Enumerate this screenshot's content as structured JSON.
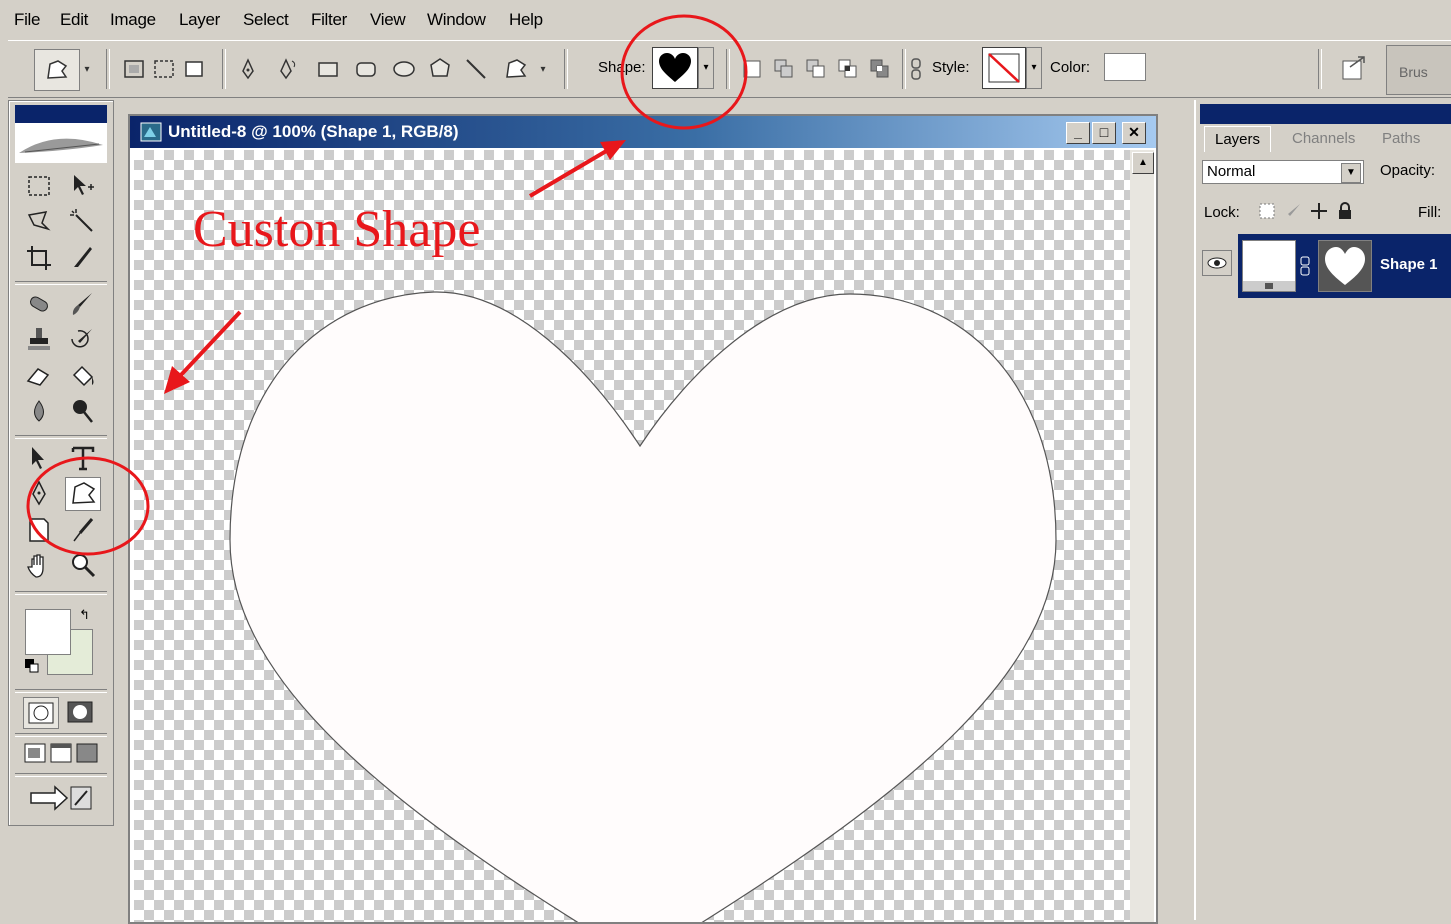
{
  "menu": {
    "items": [
      "File",
      "Edit",
      "Image",
      "Layer",
      "Select",
      "Filter",
      "View",
      "Window",
      "Help"
    ]
  },
  "options_bar": {
    "shape_label": "Shape:",
    "style_label": "Style:",
    "color_label": "Color:",
    "brushes_tab": "Brus"
  },
  "document": {
    "title": "Untitled-8 @ 100% (Shape 1, RGB/8)",
    "minimize": "_",
    "maximize": "□",
    "close": "✕"
  },
  "layers_panel": {
    "tabs": [
      "Layers",
      "Channels",
      "Paths"
    ],
    "blend_mode": "Normal",
    "opacity_label": "Opacity:",
    "lock_label": "Lock:",
    "fill_label": "Fill:",
    "layer": {
      "name": "Shape 1",
      "visible": true
    }
  },
  "annotations": {
    "caption": "Custon Shape",
    "color": "#e8171b"
  },
  "colors": {
    "selection_blue": "#0a246a",
    "ui_gray": "#d4d0c8",
    "foreground_swatch": "#ffffff",
    "background_swatch": "#e4ecd8"
  },
  "icons": {
    "toolbox": [
      "marquee-icon",
      "move-icon",
      "lasso-icon",
      "magic-wand-icon",
      "crop-icon",
      "slice-icon",
      "healing-brush-icon",
      "brush-icon",
      "clone-stamp-icon",
      "history-brush-icon",
      "eraser-icon",
      "paint-bucket-icon",
      "blur-icon",
      "dodge-icon",
      "path-selection-icon",
      "type-icon",
      "pen-icon",
      "custom-shape-icon",
      "notes-icon",
      "eyedropper-icon",
      "hand-icon",
      "zoom-icon"
    ]
  }
}
